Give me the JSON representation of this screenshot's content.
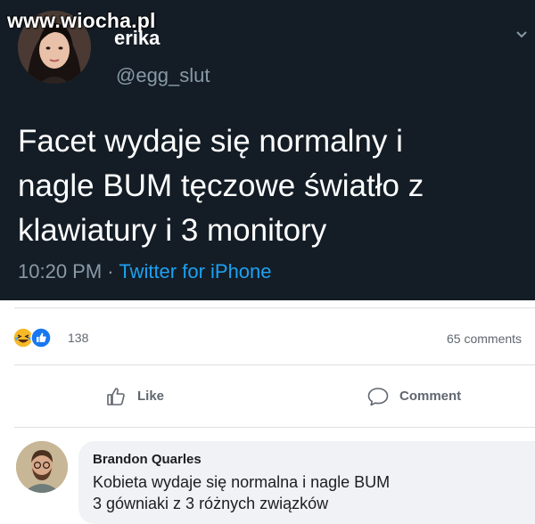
{
  "watermark": "www.wiocha.pl",
  "tweet": {
    "name": "erika",
    "handle": "@egg_slut",
    "text_lines": [
      "Facet wydaje się normalny i",
      "nagle BUM tęczowe światło z",
      "klawiatury i 3 monitory"
    ],
    "time": "10:20 PM",
    "separator": " · ",
    "source": "Twitter for iPhone",
    "colors": {
      "background": "#141d26",
      "meta": "#8899a6",
      "link": "#1da1f2"
    }
  },
  "facebook": {
    "reaction_count": "138",
    "comments_count": "65 comments",
    "actions": {
      "like": "Like",
      "comment": "Comment"
    },
    "comment": {
      "author": "Brandon Quarles",
      "text_lines": [
        "Kobieta wydaje się normalna i nagle BUM",
        "3 gówniaki z 3 różnych związków"
      ]
    },
    "colors": {
      "bubble": "#f0f2f5",
      "secondary_text": "#606770",
      "like_blue": "#1877f2"
    }
  },
  "icons": [
    "laugh-reaction-icon",
    "like-reaction-icon",
    "thumbs-up-icon",
    "comment-icon",
    "chevron-down-icon"
  ]
}
